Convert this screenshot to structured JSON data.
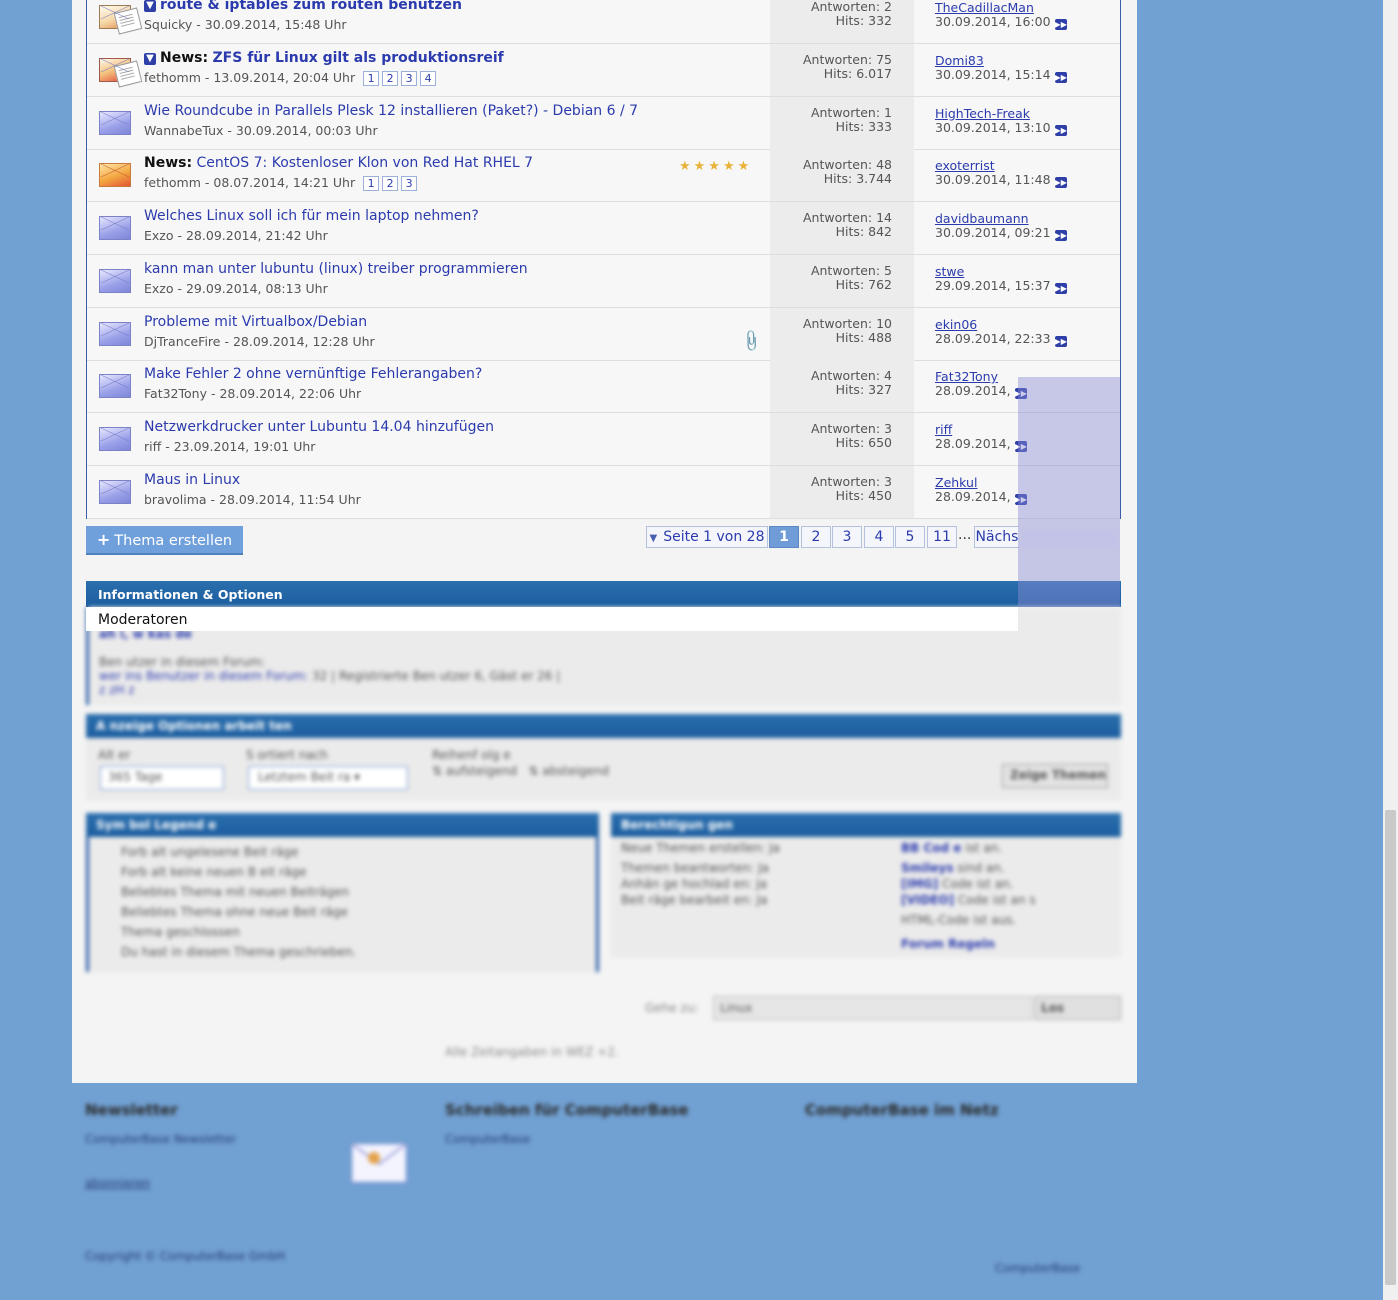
{
  "threads": [
    {
      "icon": "sticky",
      "sticky": true,
      "prefix": "",
      "title": "route & iptables zum routen benutzen",
      "author": "Squicky",
      "date": "30.09.2014, 15:48 Uhr",
      "pages": [],
      "replies": "Antworten: 2",
      "hits": "Hits: 332",
      "last_user": "TheCadillacMan",
      "last_date": "30.09.2014, 16:00",
      "stars": "",
      "attachment": false,
      "bold": true
    },
    {
      "icon": "sticky-hot",
      "sticky": true,
      "prefix": "News:",
      "title": "ZFS für Linux gilt als produktionsreif",
      "author": "fethomm",
      "date": "13.09.2014, 20:04 Uhr",
      "pages": [
        "1",
        "2",
        "3",
        "4"
      ],
      "replies": "Antworten: 75",
      "hits": "Hits: 6.017",
      "last_user": "Domi83",
      "last_date": "30.09.2014, 15:14",
      "stars": "",
      "attachment": false,
      "bold": true
    },
    {
      "icon": "normal",
      "sticky": false,
      "prefix": "",
      "title": "Wie Roundcube in Parallels Plesk 12 installieren (Paket?) - Debian 6 / 7",
      "author": "WannabeTux",
      "date": "30.09.2014, 00:03 Uhr",
      "pages": [],
      "replies": "Antworten: 1",
      "hits": "Hits: 333",
      "last_user": "HighTech-Freak",
      "last_date": "30.09.2014, 13:10",
      "stars": "",
      "attachment": false,
      "bold": false
    },
    {
      "icon": "hot",
      "sticky": false,
      "prefix": "News:",
      "title": "CentOS 7: Kostenloser Klon von Red Hat RHEL 7",
      "author": "fethomm",
      "date": "08.07.2014, 14:21 Uhr",
      "pages": [
        "1",
        "2",
        "3"
      ],
      "replies": "Antworten: 48",
      "hits": "Hits: 3.744",
      "last_user": "exoterrist",
      "last_date": "30.09.2014, 11:48",
      "stars": "★★★★★",
      "attachment": false,
      "bold": false
    },
    {
      "icon": "normal",
      "sticky": false,
      "prefix": "",
      "title": "Welches Linux soll ich für mein laptop nehmen?",
      "author": "Exzo",
      "date": "28.09.2014, 21:42 Uhr",
      "pages": [],
      "replies": "Antworten: 14",
      "hits": "Hits: 842",
      "last_user": "davidbaumann",
      "last_date": "30.09.2014, 09:21",
      "stars": "",
      "attachment": false,
      "bold": false
    },
    {
      "icon": "normal",
      "sticky": false,
      "prefix": "",
      "title": "kann man unter lubuntu (linux) treiber programmieren",
      "author": "Exzo",
      "date": "29.09.2014, 08:13 Uhr",
      "pages": [],
      "replies": "Antworten: 5",
      "hits": "Hits: 762",
      "last_user": "stwe",
      "last_date": "29.09.2014, 15:37",
      "stars": "",
      "attachment": false,
      "bold": false
    },
    {
      "icon": "normal",
      "sticky": false,
      "prefix": "",
      "title": "Probleme mit Virtualbox/Debian",
      "author": "DjTranceFire",
      "date": "28.09.2014, 12:28 Uhr",
      "pages": [],
      "replies": "Antworten: 10",
      "hits": "Hits: 488",
      "last_user": "ekin06",
      "last_date": "28.09.2014, 22:33",
      "stars": "",
      "attachment": true,
      "bold": false
    },
    {
      "icon": "normal",
      "sticky": false,
      "prefix": "",
      "title": "Make Fehler 2 ohne vernünftige Fehlerangaben?",
      "author": "Fat32Tony",
      "date": "28.09.2014, 22:06 Uhr",
      "pages": [],
      "replies": "Antworten: 4",
      "hits": "Hits: 327",
      "last_user": "Fat32Tony",
      "last_date": "28.09.2014,",
      "stars": "",
      "attachment": false,
      "bold": false
    },
    {
      "icon": "normal",
      "sticky": false,
      "prefix": "",
      "title": "Netzwerkdrucker unter Lubuntu 14.04 hinzufügen",
      "author": "riff",
      "date": "23.09.2014, 19:01 Uhr",
      "pages": [],
      "replies": "Antworten: 3",
      "hits": "Hits: 650",
      "last_user": "riff",
      "last_date": "28.09.2014,",
      "stars": "",
      "attachment": false,
      "bold": false
    },
    {
      "icon": "normal",
      "sticky": false,
      "prefix": "",
      "title": "Maus in Linux",
      "author": "bravolima",
      "date": "28.09.2014, 11:54 Uhr",
      "pages": [],
      "replies": "Antworten: 3",
      "hits": "Hits: 450",
      "last_user": "Zehkul",
      "last_date": "28.09.2014,",
      "stars": "",
      "attachment": false,
      "bold": false
    }
  ],
  "toolbar": {
    "new_thread_plus": "+",
    "new_thread_label": "Thema erstellen",
    "page_dropdown_label": "Seite 1 von 28",
    "pages": [
      "1",
      "2",
      "3",
      "4",
      "5",
      "11"
    ],
    "ellipsis": "...",
    "next_label": "Nächs"
  },
  "info": {
    "title": "Informationen & Optionen",
    "moderators_label": "Moderatoren"
  },
  "colors": {
    "background": "#71a0d2",
    "header_blue": "#1b5d9f",
    "link": "#2b3bad",
    "current_page": "#6f9bd6"
  },
  "icons": {
    "sticky": "arrow-down-icon",
    "goto_last": "double-arrow-right-icon",
    "attachment": "paperclip-icon",
    "thread": "envelope-icon",
    "newsletter": "mail-envelope-icon"
  }
}
